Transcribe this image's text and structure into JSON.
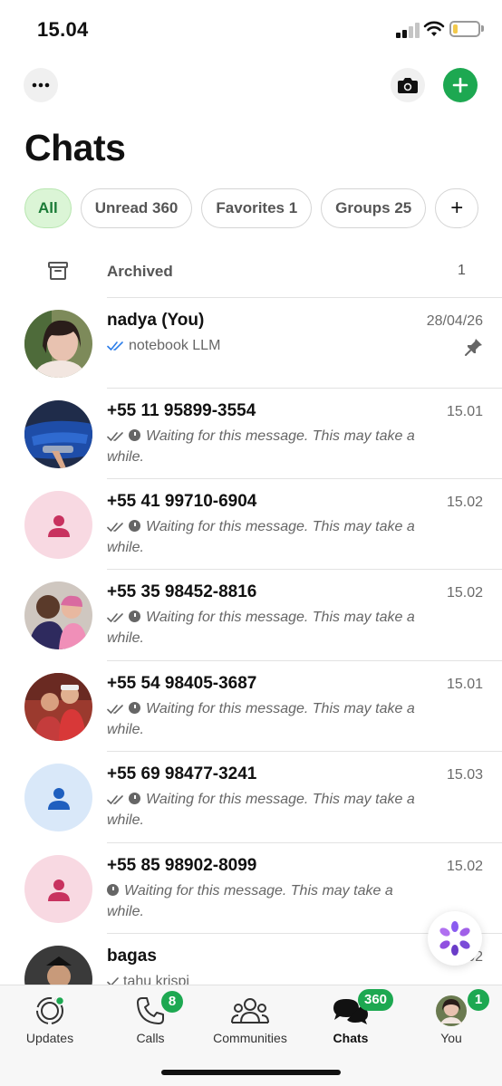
{
  "status": {
    "time": "15.04"
  },
  "header": {
    "title": "Chats"
  },
  "filters": [
    {
      "label": "All"
    },
    {
      "label": "Unread 360"
    },
    {
      "label": "Favorites 1"
    },
    {
      "label": "Groups 25"
    },
    {
      "label": "+"
    }
  ],
  "archived": {
    "label": "Archived",
    "count": "1"
  },
  "chats": [
    {
      "name": "nadya (You)",
      "time": "28/04/26",
      "message": "notebook LLM",
      "pinned": true
    },
    {
      "name": "+55 11 95899-3554",
      "time": "15.01",
      "message": "Waiting for this message. This may take a while."
    },
    {
      "name": "+55 41 99710-6904",
      "time": "15.02",
      "message": "Waiting for this message. This may take a while."
    },
    {
      "name": "+55 35 98452-8816",
      "time": "15.02",
      "message": "Waiting for this message. This may take a while."
    },
    {
      "name": "+55 54 98405-3687",
      "time": "15.01",
      "message": "Waiting for this message. This may take a while."
    },
    {
      "name": "+55 69 98477-3241",
      "time": "15.03",
      "message": "Waiting for this message. This may take a while."
    },
    {
      "name": "+55 85 98902-8099",
      "time": "15.02",
      "message": "Waiting for this message. This may take a while."
    },
    {
      "name": "bagas",
      "time": "15.02",
      "message": "tahu krispi"
    }
  ],
  "tabs": [
    {
      "label": "Updates"
    },
    {
      "label": "Calls",
      "badge": "8"
    },
    {
      "label": "Communities"
    },
    {
      "label": "Chats",
      "badge": "360"
    },
    {
      "label": "You",
      "badge": "1"
    }
  ],
  "colors": {
    "accent": "#1da851",
    "chip_active_bg": "#dbf5d6",
    "read_tick": "#2b7de9"
  }
}
